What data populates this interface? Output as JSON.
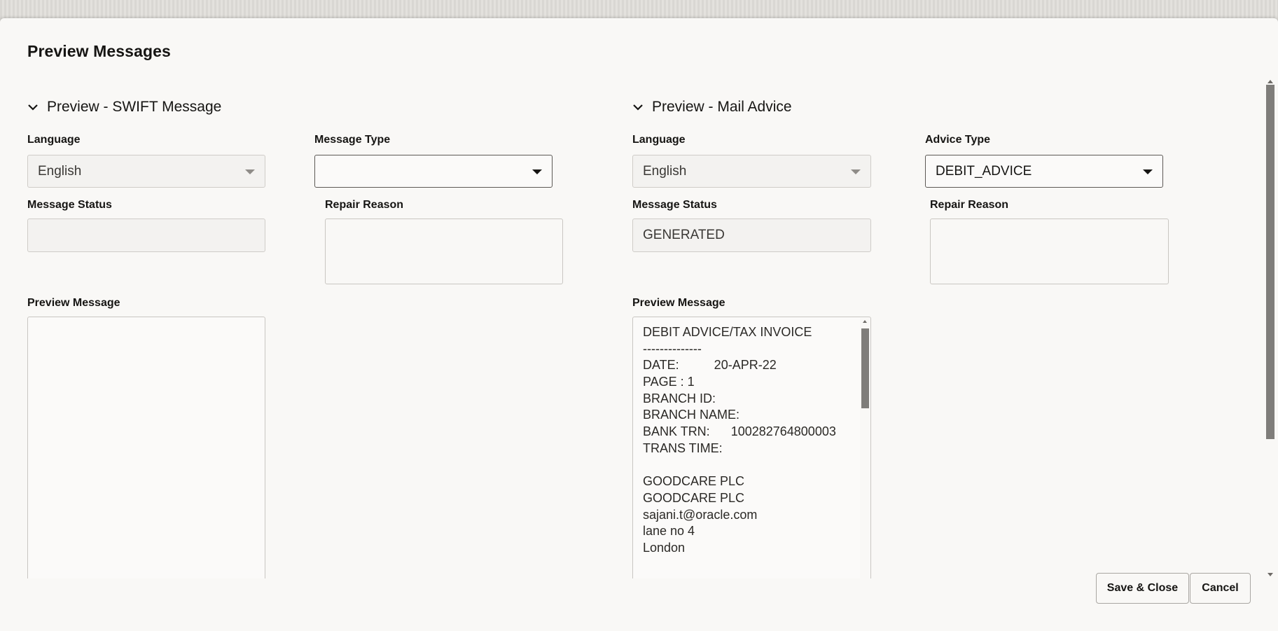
{
  "dialog": {
    "title": "Preview Messages"
  },
  "swift": {
    "section_title": "Preview - SWIFT Message",
    "language_label": "Language",
    "language_value": "English",
    "message_type_label": "Message Type",
    "message_type_value": "",
    "message_status_label": "Message Status",
    "message_status_value": "",
    "repair_reason_label": "Repair Reason",
    "repair_reason_value": "",
    "preview_label": "Preview Message",
    "preview_lines": []
  },
  "mail": {
    "section_title": "Preview - Mail Advice",
    "language_label": "Language",
    "language_value": "English",
    "advice_type_label": "Advice Type",
    "advice_type_value": "DEBIT_ADVICE",
    "message_status_label": "Message Status",
    "message_status_value": "GENERATED",
    "repair_reason_label": "Repair Reason",
    "repair_reason_value": "",
    "preview_label": "Preview Message",
    "preview_lines": [
      "DEBIT ADVICE/TAX INVOICE",
      "--------------",
      "DATE:          20-APR-22",
      "PAGE : 1",
      "BRANCH ID:",
      "BRANCH NAME:",
      "BANK TRN:      100282764800003",
      "TRANS TIME:",
      "",
      "GOODCARE PLC",
      "GOODCARE PLC",
      "sajani.t@oracle.com",
      "lane no 4",
      "London",
      ""
    ]
  },
  "footer": {
    "save_close_label": "Save & Close",
    "cancel_label": "Cancel"
  },
  "icons": {
    "section_toggle": "chevron-down-icon",
    "dropdown": "caret-down-icon"
  }
}
